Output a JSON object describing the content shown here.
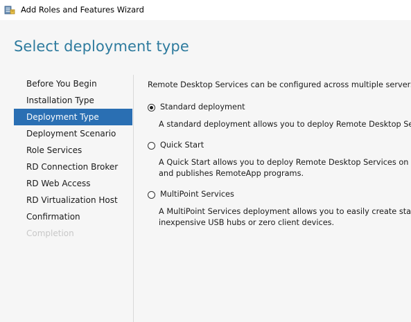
{
  "window": {
    "title": "Add Roles and Features Wizard",
    "icon": "server-manager-icon"
  },
  "page": {
    "title": "Select deployment type"
  },
  "nav": {
    "items": [
      {
        "label": "Before You Begin",
        "state": "normal"
      },
      {
        "label": "Installation Type",
        "state": "normal"
      },
      {
        "label": "Deployment Type",
        "state": "active"
      },
      {
        "label": "Deployment Scenario",
        "state": "normal"
      },
      {
        "label": "Role Services",
        "state": "normal"
      },
      {
        "label": "RD Connection Broker",
        "state": "normal"
      },
      {
        "label": "RD Web Access",
        "state": "normal"
      },
      {
        "label": "RD Virtualization Host",
        "state": "normal"
      },
      {
        "label": "Confirmation",
        "state": "normal"
      },
      {
        "label": "Completion",
        "state": "disabled"
      }
    ]
  },
  "main": {
    "intro": "Remote Desktop Services can be configured across multiple servers or o",
    "options": [
      {
        "label": "Standard deployment",
        "checked": true,
        "description_lines": [
          "A standard deployment allows you to deploy Remote Desktop Servic"
        ]
      },
      {
        "label": "Quick Start",
        "checked": false,
        "description_lines": [
          "A Quick Start allows you to deploy Remote Desktop Services on one s",
          "and publishes RemoteApp programs."
        ]
      },
      {
        "label": "MultiPoint Services",
        "checked": false,
        "description_lines": [
          "A MultiPoint Services deployment allows you to easily create stations",
          "inexpensive USB hubs or zero client devices."
        ]
      }
    ]
  },
  "colors": {
    "title_blue": "#2e7b9e",
    "nav_active_bg": "#2a6fb3",
    "content_bg": "#f6f6f6",
    "disabled_text": "#c8c8c8"
  }
}
